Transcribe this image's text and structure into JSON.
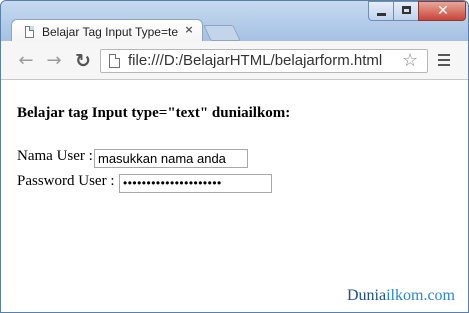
{
  "browser": {
    "tab": {
      "title": "Belajar Tag Input Type=te",
      "close_glyph": "×"
    },
    "address_bar": {
      "url": "file:///D:/BelajarHTML/belajarform.html"
    },
    "nav": {
      "back_glyph": "←",
      "forward_glyph": "→",
      "reload_glyph": "↻"
    },
    "icons": [
      "page-icon",
      "star-icon",
      "menu-icon",
      "minimize-icon",
      "maximize-icon",
      "close-icon"
    ]
  },
  "page": {
    "heading": "Belajar tag Input type=\"text\" duniailkom:",
    "username": {
      "label": "Nama User :",
      "value": "masukkan nama anda"
    },
    "password": {
      "label": "Password User :",
      "value": "•••••••••••••••••••••"
    }
  },
  "watermark": {
    "part1": "Dunia",
    "part2": "ilkom.com"
  },
  "colors": {
    "titlebar": "#a9c5e6",
    "close_button": "#c8453a",
    "watermark_dark": "#1f4f8f",
    "watermark_light": "#2a86d6"
  }
}
